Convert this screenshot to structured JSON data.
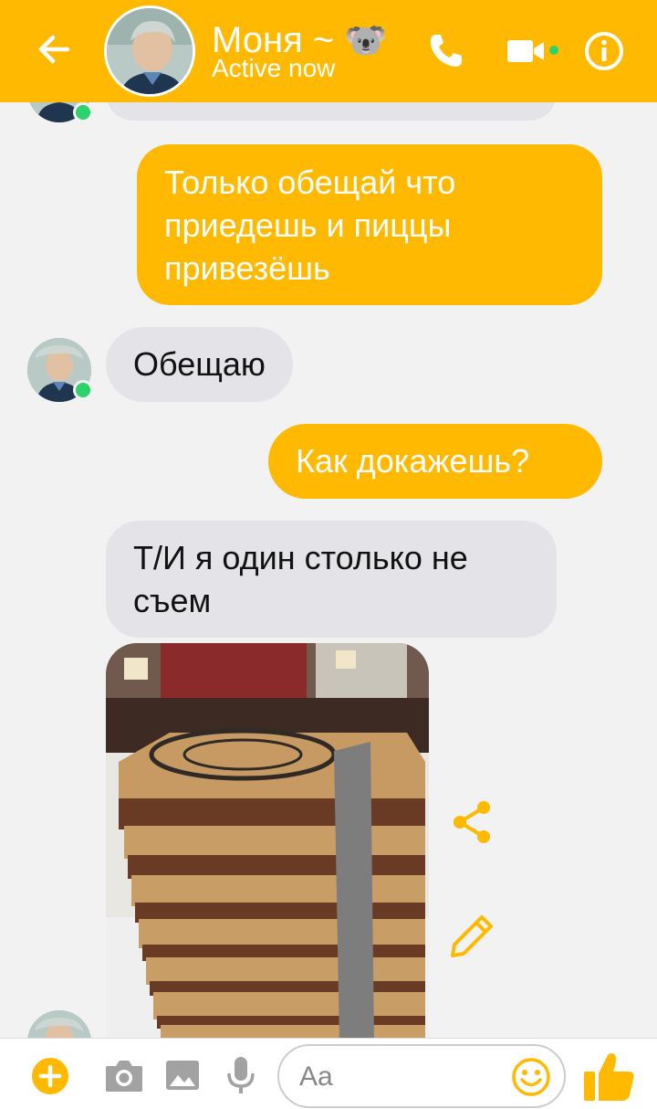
{
  "header": {
    "contact_name": "Моня ~",
    "contact_emoji": "🐨",
    "status": "Active now"
  },
  "messages": [
    {
      "direction": "out",
      "text": "Только обещай что приедешь и пиццы привезёшь"
    },
    {
      "direction": "in",
      "text": "Обещаю"
    },
    {
      "direction": "out",
      "text": "Как докажешь?"
    },
    {
      "direction": "in",
      "text": "Т/И я один столько не съем"
    }
  ],
  "composer": {
    "placeholder": "Aa"
  },
  "colors": {
    "accent": "#ffb900",
    "incoming_bubble": "#e4e3e8",
    "online": "#2bd36b"
  },
  "icons": [
    "back-arrow-icon",
    "phone-icon",
    "video-camera-icon",
    "info-icon",
    "share-icon",
    "edit-pencil-icon",
    "plus-icon",
    "camera-icon",
    "gallery-icon",
    "microphone-icon",
    "emoji-icon",
    "thumbs-up-icon"
  ]
}
